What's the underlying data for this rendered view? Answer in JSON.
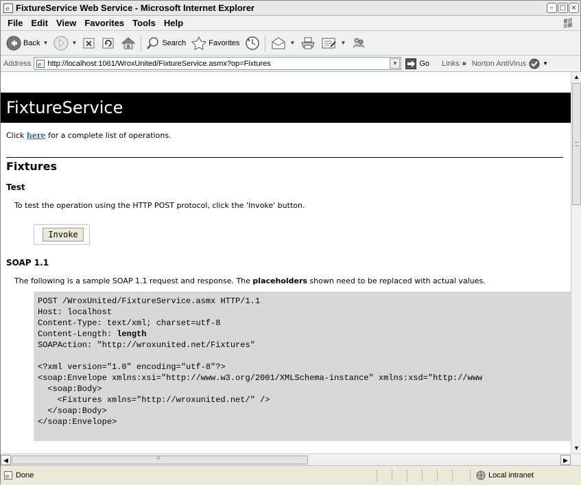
{
  "window": {
    "title": "FixtureService Web Service - Microsoft Internet Explorer"
  },
  "menu": [
    "File",
    "Edit",
    "View",
    "Favorites",
    "Tools",
    "Help"
  ],
  "toolbar": {
    "back_label": "Back",
    "search_label": "Search",
    "favorites_label": "Favorites"
  },
  "address": {
    "label": "Address",
    "url": "http://localhost:1061/WroxUnited/FixtureService.asmx?op=Fixtures",
    "go_label": "Go",
    "links_label": "Links",
    "more_label": "»",
    "norton_label": "Norton AntiVirus"
  },
  "page": {
    "banner": "FixtureService",
    "intro_pre": "Click ",
    "intro_link": "here",
    "intro_post": " for a complete list of operations.",
    "heading": "Fixtures",
    "test_heading": "Test",
    "test_desc": "To test the operation using the HTTP POST protocol, click the 'Invoke' button.",
    "invoke_label": "Invoke",
    "soap_heading": "SOAP 1.1",
    "soap_desc_pre": "The following is a sample SOAP 1.1 request and response. The ",
    "soap_desc_bold": "placeholders",
    "soap_desc_post": " shown need to be replaced with actual values.",
    "code": {
      "l1": "POST /WroxUnited/FixtureService.asmx HTTP/1.1",
      "l2": "Host: localhost",
      "l3": "Content-Type: text/xml; charset=utf-8",
      "l4_pre": "Content-Length: ",
      "l4_bold": "length",
      "l5": "SOAPAction: \"http://wroxunited.net/Fixtures\"",
      "l7": "<?xml version=\"1.0\" encoding=\"utf-8\"?>",
      "l8": "<soap:Envelope xmlns:xsi=\"http://www.w3.org/2001/XMLSchema-instance\" xmlns:xsd=\"http://www",
      "l9": "  <soap:Body>",
      "l10": "    <Fixtures xmlns=\"http://wroxunited.net/\" />",
      "l11": "  </soap:Body>",
      "l12": "</soap:Envelope>"
    }
  },
  "status": {
    "text": "Done",
    "zone": "Local intranet"
  },
  "scrollbar": {
    "hgrip": "III"
  }
}
